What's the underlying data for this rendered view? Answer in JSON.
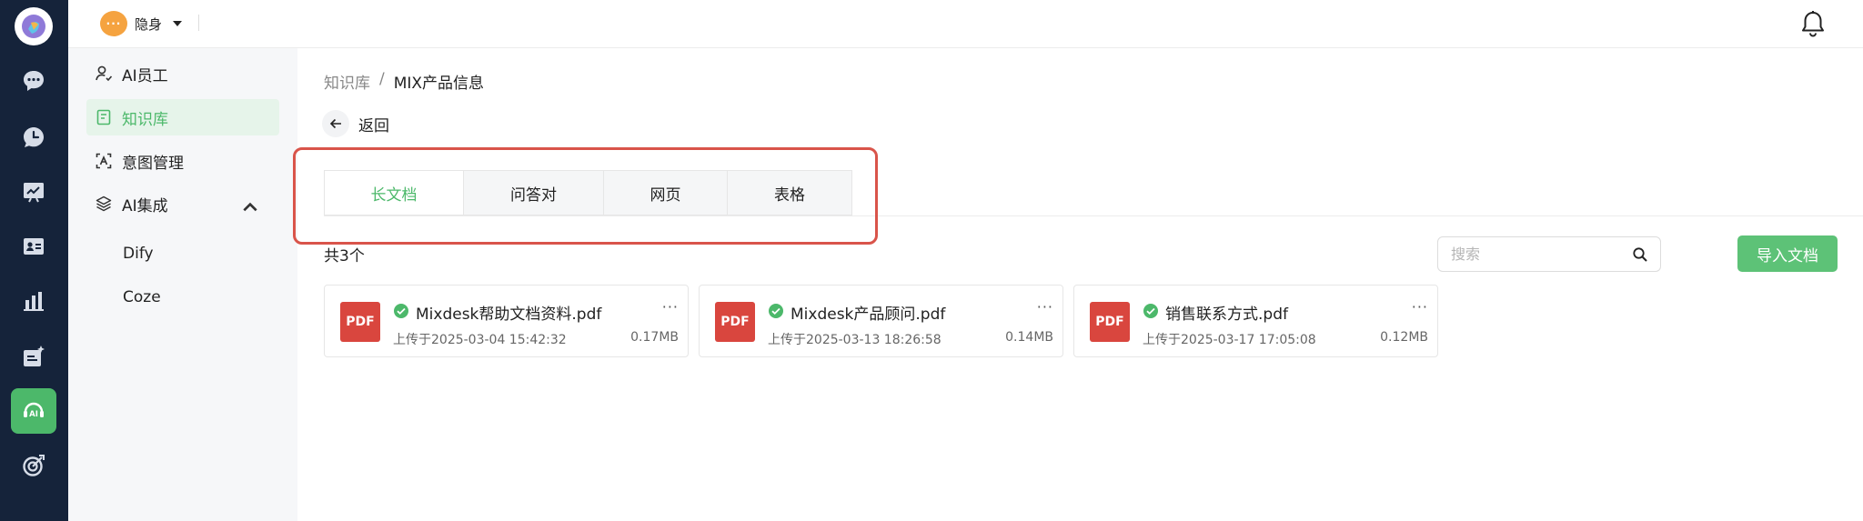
{
  "topbar": {
    "status_icon_text": "···",
    "status_label": "隐身"
  },
  "rail": {
    "items": [
      "chat-icon",
      "history-icon",
      "presentation-icon",
      "contact-card-icon",
      "analytics-icon",
      "ai-app-icon",
      "ai-headset-icon",
      "target-icon"
    ],
    "active_index": 6
  },
  "sidebar": {
    "items": [
      {
        "label": "AI员工",
        "icon": "user-icon"
      },
      {
        "label": "知识库",
        "icon": "book-icon",
        "active": true
      },
      {
        "label": "意图管理",
        "icon": "intent-icon"
      },
      {
        "label": "AI集成",
        "icon": "layers-icon"
      }
    ],
    "sub_items": [
      "Dify",
      "Coze"
    ]
  },
  "breadcrumb": {
    "root": "知识库",
    "separator": "/",
    "current": "MIX产品信息"
  },
  "back_label": "返回",
  "tabs": [
    {
      "label": "长文档",
      "active": true
    },
    {
      "label": "问答对"
    },
    {
      "label": "网页"
    },
    {
      "label": "表格"
    }
  ],
  "count_label": "共3个",
  "search": {
    "placeholder": "搜索"
  },
  "import_label": "导入文档",
  "files": [
    {
      "badge": "PDF",
      "name": "Mixdesk帮助文档资料.pdf",
      "uploaded": "上传于2025-03-04 15:42:32",
      "size": "0.17MB",
      "more": "···"
    },
    {
      "badge": "PDF",
      "name": "Mixdesk产品顾问.pdf",
      "uploaded": "上传于2025-03-13 18:26:58",
      "size": "0.14MB",
      "more": "···"
    },
    {
      "badge": "PDF",
      "name": "销售联系方式.pdf",
      "uploaded": "上传于2025-03-17 17:05:08",
      "size": "0.12MB",
      "more": "···"
    }
  ],
  "colors": {
    "rail_bg": "#15233a",
    "accent_green": "#4cb86a",
    "pdf_red": "#d9463e",
    "highlight_red": "#d9544a"
  }
}
